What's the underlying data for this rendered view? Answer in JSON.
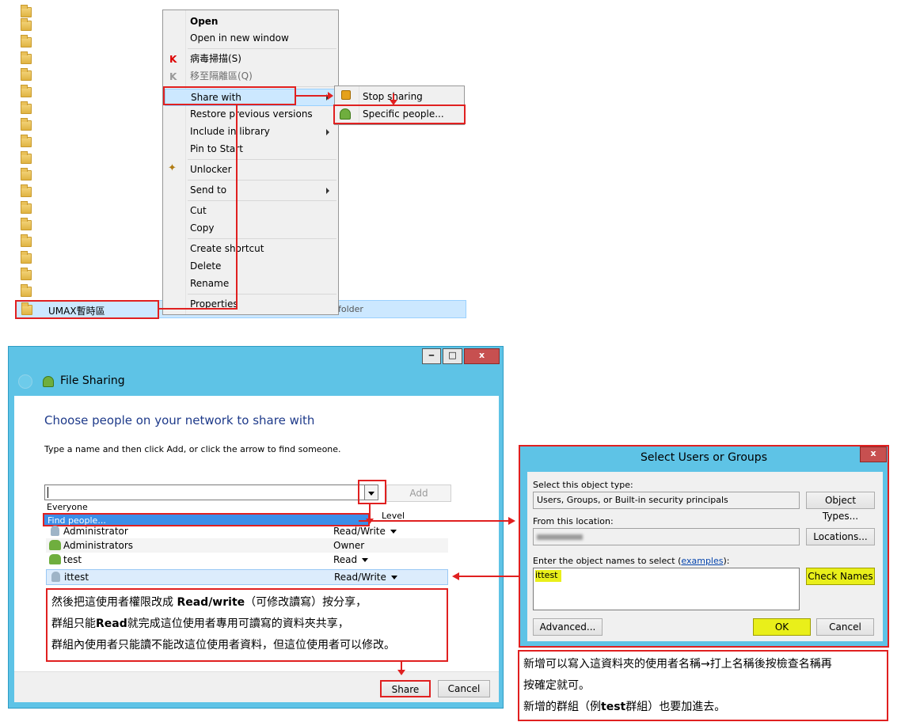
{
  "explorer": {
    "selected_folder": "UMAX暫時區",
    "selected_type": "folder"
  },
  "context_menu": {
    "items": [
      {
        "label": "Open"
      },
      {
        "label": "Open in new window"
      },
      {
        "label": "病毒掃描(S)"
      },
      {
        "label": "移至隔離區(Q)"
      },
      {
        "label": "Share with"
      },
      {
        "label": "Restore previous versions"
      },
      {
        "label": "Include in library"
      },
      {
        "label": "Pin to Start"
      },
      {
        "label": "Unlocker"
      },
      {
        "label": "Send to"
      },
      {
        "label": "Cut"
      },
      {
        "label": "Copy"
      },
      {
        "label": "Create shortcut"
      },
      {
        "label": "Delete"
      },
      {
        "label": "Rename"
      },
      {
        "label": "Properties"
      }
    ],
    "submenu": [
      {
        "label": "Stop sharing",
        "icon": "lock-icon"
      },
      {
        "label": "Specific people...",
        "icon": "people-icon"
      }
    ]
  },
  "file_sharing": {
    "title": "File Sharing",
    "heading": "Choose people on your network to share with",
    "instruction": "Type a name and then click Add, or click the arrow to find someone.",
    "name_input_value": "",
    "add_button": "Add",
    "dropdown_options": [
      "Everyone",
      "Find people..."
    ],
    "permission_header": "Level",
    "rows": [
      {
        "name": "Administrator",
        "level": "Read/Write",
        "icon": "user-icon"
      },
      {
        "name": "Administrators",
        "level": "Owner",
        "icon": "group-icon"
      },
      {
        "name": "test",
        "level": "Read",
        "icon": "group-icon"
      },
      {
        "name": "ittest",
        "level": "Read/Write",
        "icon": "user-icon"
      }
    ],
    "share_button": "Share",
    "cancel_button": "Cancel",
    "window_controls": {
      "minimize": "‒",
      "maximize": "□",
      "close": "x"
    }
  },
  "note_left": {
    "line1_a": "然後把這使用者權限改成 ",
    "line1_b": "Read/write",
    "line1_c": "（可修改讀寫）按分享，",
    "line2_a": "群組只能",
    "line2_b": "Read",
    "line2_c": "就完成這位使用者專用可讀寫的資料夾共享，",
    "line3": "群組內使用者只能讀不能改這位使用者資料，但這位使用者可以修改。"
  },
  "select_users": {
    "title": "Select Users or Groups",
    "close": "x",
    "object_type_label": "Select this object type:",
    "object_type_value": "Users, Groups, or Built-in security principals",
    "object_types_button": "Object Types...",
    "location_label": "From this location:",
    "locations_button": "Locations...",
    "names_label": "Enter the object names to select (",
    "names_label_link": "examples",
    "names_label_end": "):",
    "names_value": "ittest",
    "check_names_button": "Check Names",
    "advanced_button": "Advanced...",
    "ok_button": "OK",
    "cancel_button": "Cancel"
  },
  "note_right": {
    "line1": "新增可以寫入這資料夾的使用者名稱→打上名稱後按檢查名稱再",
    "line2": "按確定就可。",
    "line3_a": "新增的群組（例",
    "line3_b": "test",
    "line3_c": "群組）也要加進去。"
  },
  "colors": {
    "annotation_red": "#e02020",
    "window_frame": "#5ec3e6",
    "selection": "#3b8ee8",
    "highlight_yellow": "#e9ef1a"
  }
}
